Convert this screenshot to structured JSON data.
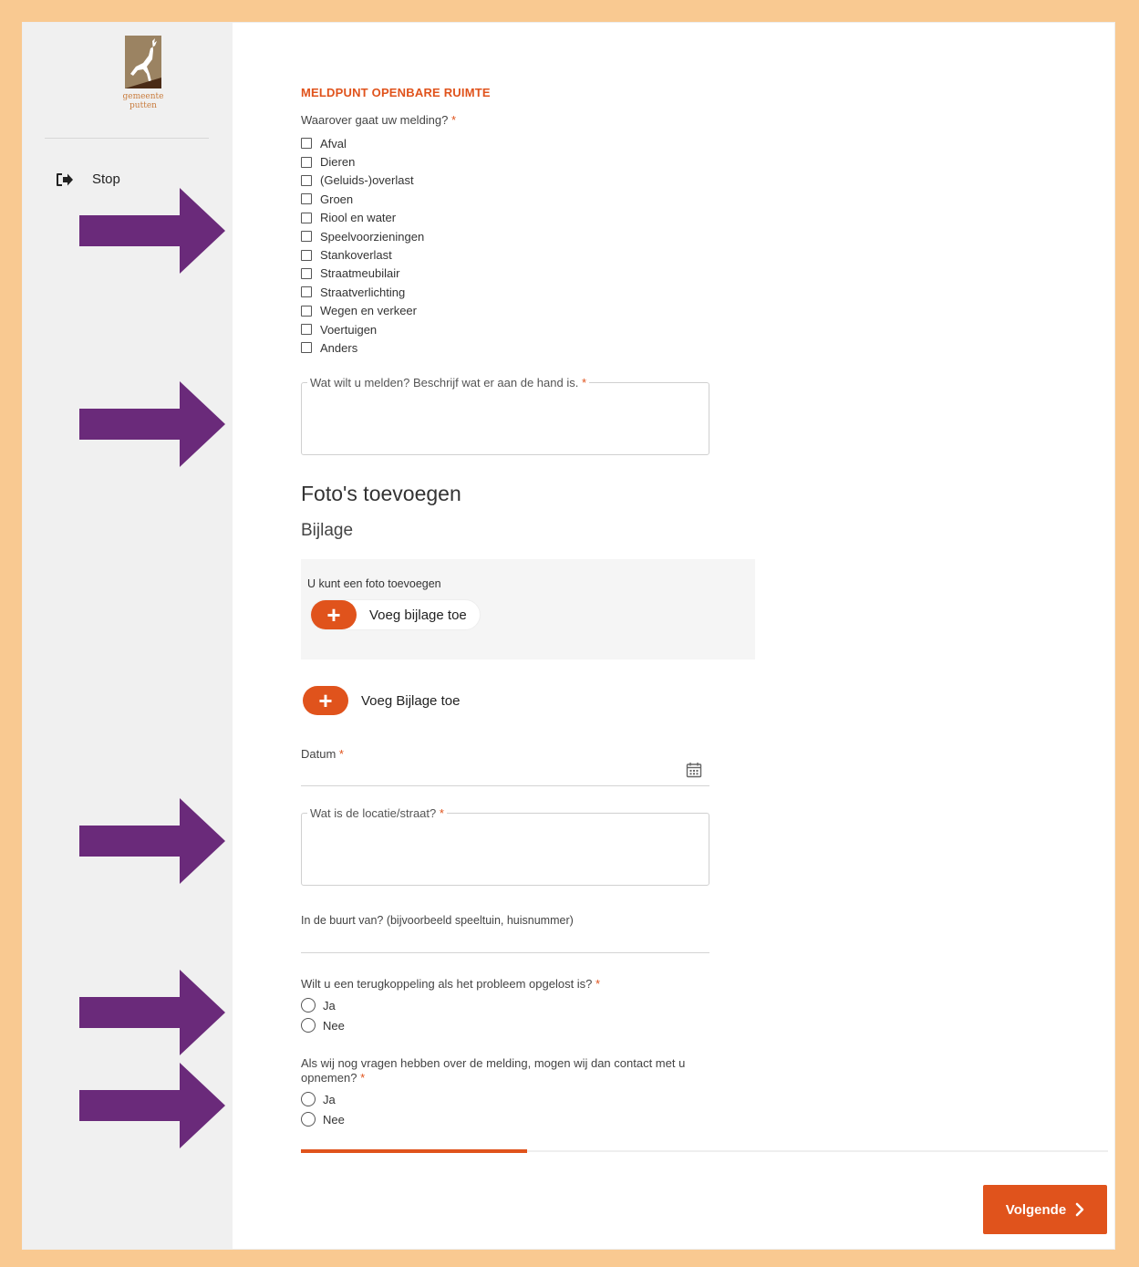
{
  "sidebar": {
    "logo_text_line1": "gemeente",
    "logo_text_line2": "putten",
    "stop_label": "Stop"
  },
  "form": {
    "title": "MELDPUNT OPENBARE RUIMTE",
    "topic_question": "Waarover gaat uw melding?",
    "required_mark": "*",
    "topic_options": [
      "Afval",
      "Dieren",
      "(Geluids-)overlast",
      "Groen",
      "Riool en water",
      "Speelvoorzieningen",
      "Stankoverlast",
      "Straatmeubilair",
      "Straatverlichting",
      "Wegen en verkeer",
      "Voertuigen",
      "Anders"
    ],
    "description_label": "Wat wilt u melden? Beschrijf wat er aan de hand is.",
    "photos_heading": "Foto's toevoegen",
    "attachment_heading": "Bijlage",
    "attachment_hint": "U kunt een foto toevoegen",
    "add_attachment_label": "Voeg bijlage toe",
    "add_attachment_label_2": "Voeg Bijlage toe",
    "date_label": "Datum",
    "location_label": "Wat is de locatie/straat?",
    "nearby_label": "In de buurt van? (bijvoorbeeld speeltuin, huisnummer)",
    "feedback_question": "Wilt u een terugkoppeling als het probleem opgelost is?",
    "feedback_options": [
      "Ja",
      "Nee"
    ],
    "contact_question": "Als wij nog vragen hebben over de melding, mogen wij dan contact met u opnemen?",
    "contact_options": [
      "Ja",
      "Nee"
    ],
    "progress_fraction": 0.28,
    "next_label": "Volgende"
  },
  "annotations": {
    "arrow_color": "#6a2a7a"
  },
  "colors": {
    "accent": "#e0531c",
    "outer_frame": "#f9c991",
    "sidebar_bg": "#f0f0f0"
  }
}
